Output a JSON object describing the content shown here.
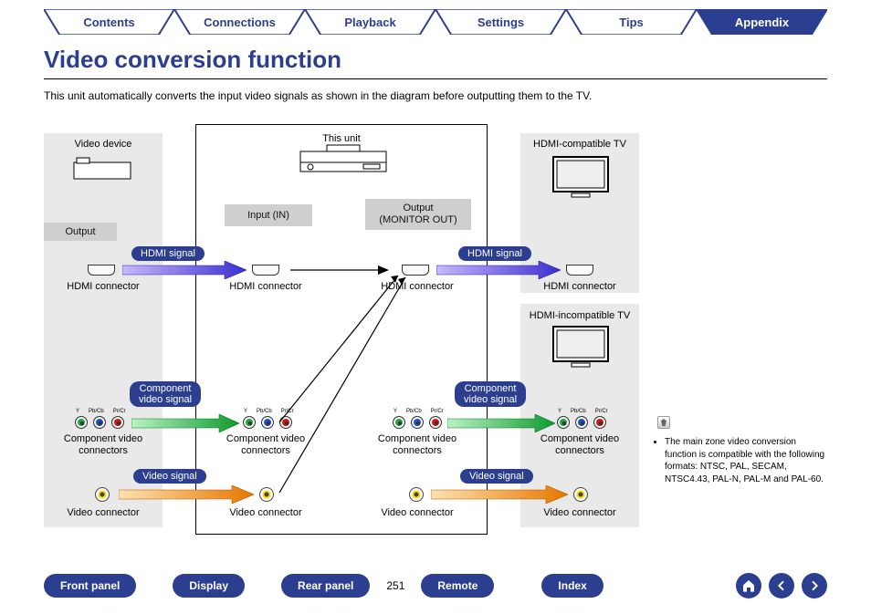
{
  "tabs": {
    "items": [
      {
        "label": "Contents"
      },
      {
        "label": "Connections"
      },
      {
        "label": "Playback"
      },
      {
        "label": "Settings"
      },
      {
        "label": "Tips"
      },
      {
        "label": "Appendix"
      }
    ],
    "active_index": 5
  },
  "title": "Video conversion function",
  "intro": "This unit automatically converts the input video signals as shown in the diagram before outputting them to the TV.",
  "diagram": {
    "video_device_label": "Video device",
    "this_unit_label": "This unit",
    "hdmi_tv_label": "HDMI-compatible TV",
    "non_hdmi_tv_label": "HDMI-incompatible TV",
    "input_label": "Input (IN)",
    "output_label": "Output\n(MONITOR OUT)",
    "device_output_label": "Output",
    "hdmi_signal_label": "HDMI signal",
    "component_signal_label": "Component\nvideo signal",
    "video_signal_label": "Video signal",
    "hdmi_connector_label": "HDMI connector",
    "component_connectors_label": "Component video\nconnectors",
    "video_connector_label": "Video connector",
    "component_pins": [
      "Y",
      "Pb/Cb",
      "Pr/Cr"
    ]
  },
  "note": {
    "text": "The main zone video conversion function is compatible with the following formats: NTSC, PAL, SECAM, NTSC4.43, PAL-N, PAL-M and PAL-60."
  },
  "bottom_nav": {
    "front_panel": "Front panel",
    "display": "Display",
    "rear_panel": "Rear panel",
    "remote": "Remote",
    "index": "Index",
    "page_number": "251"
  },
  "icons": {
    "home": "home-icon",
    "prev": "arrow-left-icon",
    "next": "arrow-right-icon",
    "pencil": "pencil-icon"
  },
  "colors": {
    "navy": "#2b3e8f",
    "hdmi_arrow_start": "#5c3bd6",
    "hdmi_arrow_end": "#2a2ad1",
    "component_arrow_start": "#1ea83b",
    "component_arrow_end": "#0f7a26",
    "video_arrow_start": "#f5a623",
    "video_arrow_end": "#e07b00"
  }
}
